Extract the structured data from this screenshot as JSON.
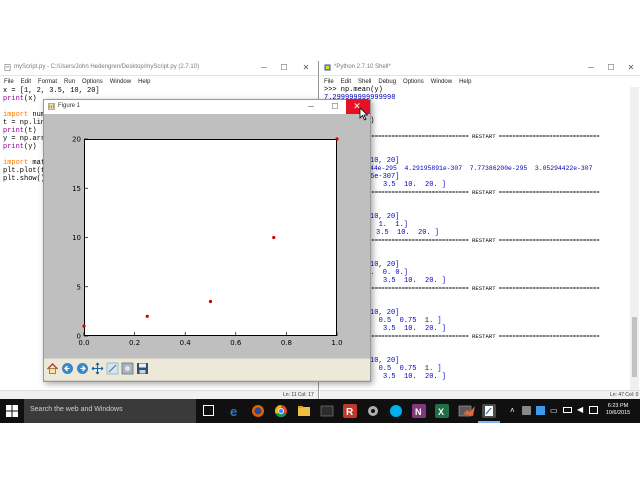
{
  "editor": {
    "title": "myScript.py - C:/Users/John Hedengren/Desktop/myScript.py (2.7.10)",
    "menus": [
      "File",
      "Edit",
      "Format",
      "Run",
      "Options",
      "Window",
      "Help"
    ],
    "lines": {
      "l1": "x = [1, 2, 3.5, 10, 20]",
      "l2_kw": "print",
      "l2_rest": "(x)",
      "l4_kw": "import",
      "l4_rest": " num",
      "l5": "t = np.lin",
      "l6_kw": "print",
      "l6_rest": "(t)",
      "l7": "y = np.arr",
      "l8_kw": "print",
      "l8_rest": "(y)",
      "l10_kw": "import",
      "l10_rest": " mat",
      "l11": "plt.plot(t",
      "l12": "plt.show()"
    },
    "status": "Ln: 11  Col: 17"
  },
  "shell": {
    "title": "*Python 2.7.10 Shell*",
    "menus": [
      "File",
      "Edit",
      "Shell",
      "Debug",
      "Options",
      "Window",
      "Help"
    ],
    "lines": {
      "s1": ">>> np.mean(y)",
      "s2": "7.299999999999998",
      "s3": ")",
      "s4": "y)",
      "r1": "============================== RESTART ==============================",
      "s5": "10, 20]",
      "s6": "44e-295  4.29195891e-307  7.77386200e-295  3.05294422e-307",
      "s7": "6e-307]",
      "s8": "3.5  10.  20. ]",
      "r2": "============================== RESTART ==============================",
      "s9": "10, 20]",
      "s10": ".  1.  1.]",
      "s11": "3.5  10.  20. ]",
      "r3": "============================== RESTART ==============================",
      "s12": "10, 20]",
      "s13": "0.  0. 0.]",
      "s14": "3.5  10.  20. ]",
      "r4": "============================== RESTART ==============================",
      "s15": "10, 20]",
      "s16": "5  0.5  0.75  1. ]",
      "s17": "3.5  10.  20. ]",
      "r5": "============================== RESTART ==============================",
      "s18": "10, 20]",
      "s19": "5  0.5  0.75  1. ]",
      "s20": "3.5  10.  20. ]"
    },
    "status": "Ln: 47  Col: 0"
  },
  "figure": {
    "title": "Figure 1",
    "close_tooltip_glyph": "✕"
  },
  "chart_data": {
    "type": "scatter",
    "x": [
      0.0,
      0.25,
      0.5,
      0.75,
      1.0
    ],
    "y": [
      1,
      2,
      3.5,
      10,
      20
    ],
    "xlim": [
      0.0,
      1.0
    ],
    "ylim": [
      0,
      20
    ],
    "xticks": [
      "0.0",
      "0.2",
      "0.4",
      "0.6",
      "0.8",
      "1.0"
    ],
    "yticks": [
      "0",
      "5",
      "10",
      "15",
      "20"
    ],
    "marker_color": "#cc0000"
  },
  "taskbar": {
    "search_placeholder": "Search the web and Windows",
    "time": "6:23 PM",
    "date": "10/6/2015"
  },
  "colors": {
    "close_red": "#e81123",
    "figure_bg": "#bfbfbf",
    "taskbar_bg": "#101010"
  }
}
